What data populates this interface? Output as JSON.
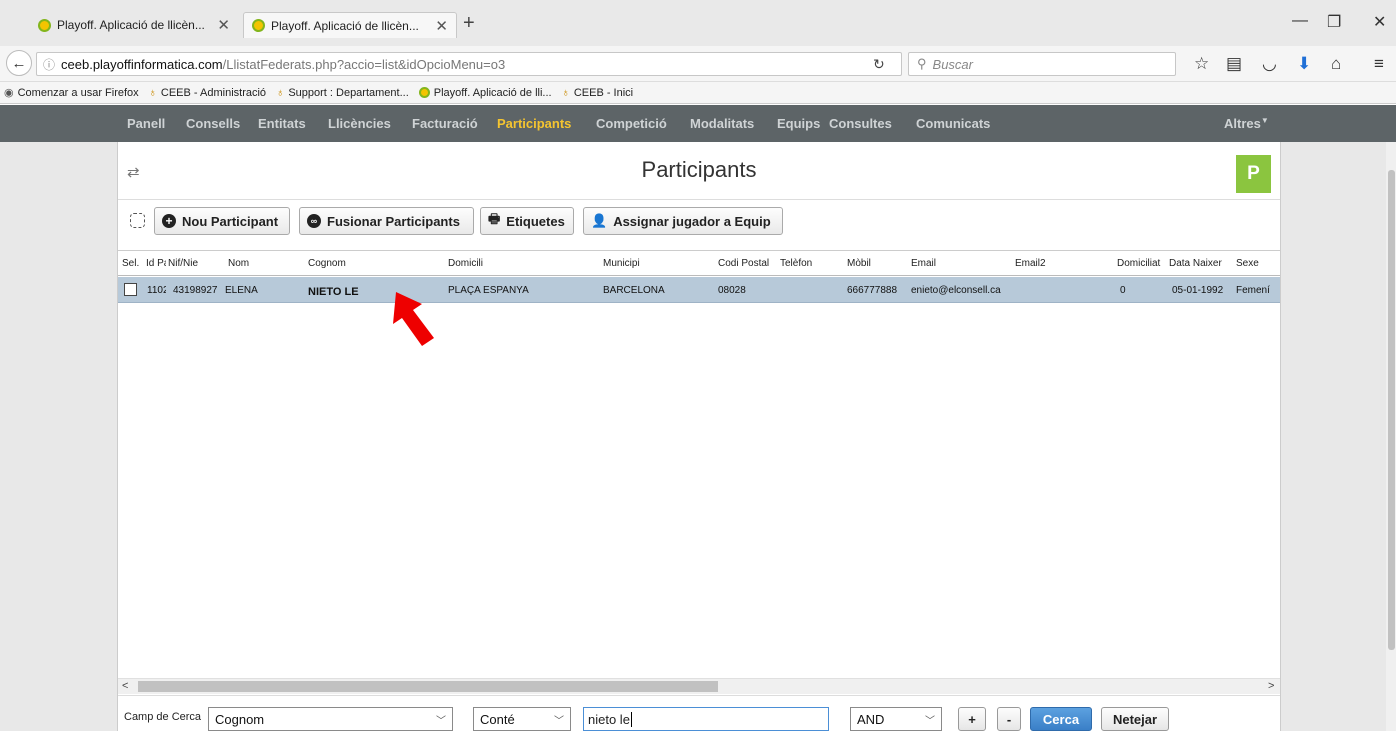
{
  "browser": {
    "tabs": [
      {
        "label": "Playoff. Aplicació de llicèn..."
      },
      {
        "label": "Playoff. Aplicació de llicèn..."
      }
    ],
    "url_host": "ceeb.playoffinformatica.com",
    "url_path": "/LlistatFederats.php?accio=list&idOpcioMenu=o3",
    "search_placeholder": "Buscar",
    "bookmarks": [
      "Comenzar a usar Firefox",
      "CEEB - Administració",
      "Support : Departament...",
      "Playoff. Aplicació de lli...",
      "CEEB - Inici"
    ]
  },
  "menu": {
    "items": [
      "Panell",
      "Consells",
      "Entitats",
      "Llicències",
      "Facturació",
      "Participants",
      "Competició",
      "Modalitats",
      "Equips",
      "Consultes",
      "Comunicats"
    ],
    "active": "Participants",
    "right": "Altres"
  },
  "page": {
    "title": "Participants",
    "logo_letter": "P"
  },
  "toolbar": {
    "new": "Nou Participant",
    "merge": "Fusionar Participants",
    "labels": "Etiquetes",
    "assign": "Assignar jugador a Equip"
  },
  "table": {
    "headers": [
      "Sel.",
      "Id Pa",
      "Nif/Nie",
      "Nom",
      "Cognom",
      "Domicili",
      "Municipi",
      "Codi Postal",
      "Telèfon",
      "Mòbil",
      "Email",
      "Email2",
      "Domiciliat",
      "Data Naixer",
      "Sexe"
    ],
    "rows": [
      {
        "id": "1102",
        "nif": "43198927",
        "nom": "ELENA",
        "cognom": "NIETO LE",
        "domicili": "PLAÇA ESPANYA",
        "municipi": "BARCELONA",
        "cp": "08028",
        "telefon": "",
        "mobil": "666777888",
        "email": "enieto@elconsell.ca",
        "email2": "",
        "domiciliat": "0",
        "data_naixer": "05-01-1992",
        "sexe": "Femení"
      }
    ]
  },
  "search": {
    "label": "Camp de Cerca",
    "field": "Cognom",
    "operator": "Conté",
    "value": "nieto le",
    "logic": "AND",
    "plus": "+",
    "minus": "-",
    "search_btn": "Cerca",
    "clear_btn": "Netejar"
  },
  "colors": {
    "menu_bg": "#5d6467",
    "menu_active": "#f4c430",
    "row_selected": "#b7c9d9",
    "logo_green": "#8bc53f",
    "arrow_red": "#ee0000",
    "search_blue": "#3a7fc7"
  }
}
